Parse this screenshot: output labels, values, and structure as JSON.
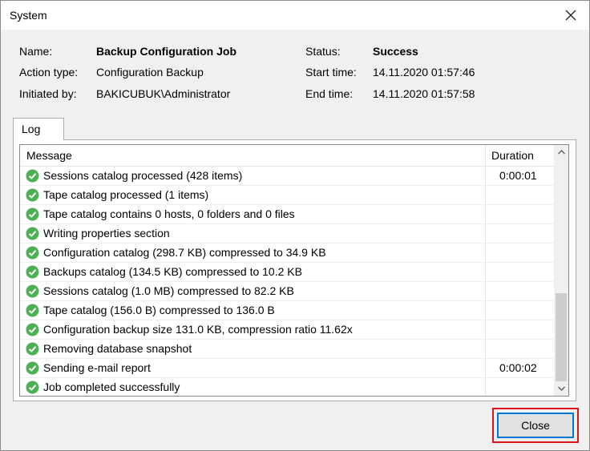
{
  "window": {
    "title": "System"
  },
  "info": {
    "name_label": "Name:",
    "name_value": "Backup Configuration Job",
    "action_label": "Action type:",
    "action_value": "Configuration Backup",
    "initiated_label": "Initiated by:",
    "initiated_value": "BAKICUBUK\\Administrator",
    "status_label": "Status:",
    "status_value": "Success",
    "start_label": "Start time:",
    "start_value": "14.11.2020 01:57:46",
    "end_label": "End time:",
    "end_value": "14.11.2020 01:57:58"
  },
  "tabs": [
    {
      "label": "Log"
    }
  ],
  "log": {
    "columns": {
      "message": "Message",
      "duration": "Duration"
    },
    "rows": [
      {
        "message": "Sessions catalog processed (428 items)",
        "duration": "0:00:01"
      },
      {
        "message": "Tape catalog processed (1 items)",
        "duration": ""
      },
      {
        "message": "Tape catalog contains 0 hosts, 0 folders and 0 files",
        "duration": ""
      },
      {
        "message": "Writing properties section",
        "duration": ""
      },
      {
        "message": "Configuration catalog (298.7 KB) compressed to 34.9 KB",
        "duration": ""
      },
      {
        "message": "Backups catalog (134.5 KB) compressed to 10.2 KB",
        "duration": ""
      },
      {
        "message": "Sessions catalog (1.0 MB) compressed to 82.2 KB",
        "duration": ""
      },
      {
        "message": "Tape catalog (156.0 B) compressed to 136.0 B",
        "duration": ""
      },
      {
        "message": "Configuration backup size 131.0 KB, compression ratio 11.62x",
        "duration": ""
      },
      {
        "message": "Removing database snapshot",
        "duration": ""
      },
      {
        "message": "Sending e-mail report",
        "duration": "0:00:02"
      },
      {
        "message": "Job completed successfully",
        "duration": ""
      }
    ],
    "row_icon": "success-check-icon"
  },
  "buttons": {
    "close_label": "Close"
  },
  "colors": {
    "success_icon": "#4caf50",
    "highlight_border": "#e0131c",
    "focus_border": "#0078d7"
  }
}
